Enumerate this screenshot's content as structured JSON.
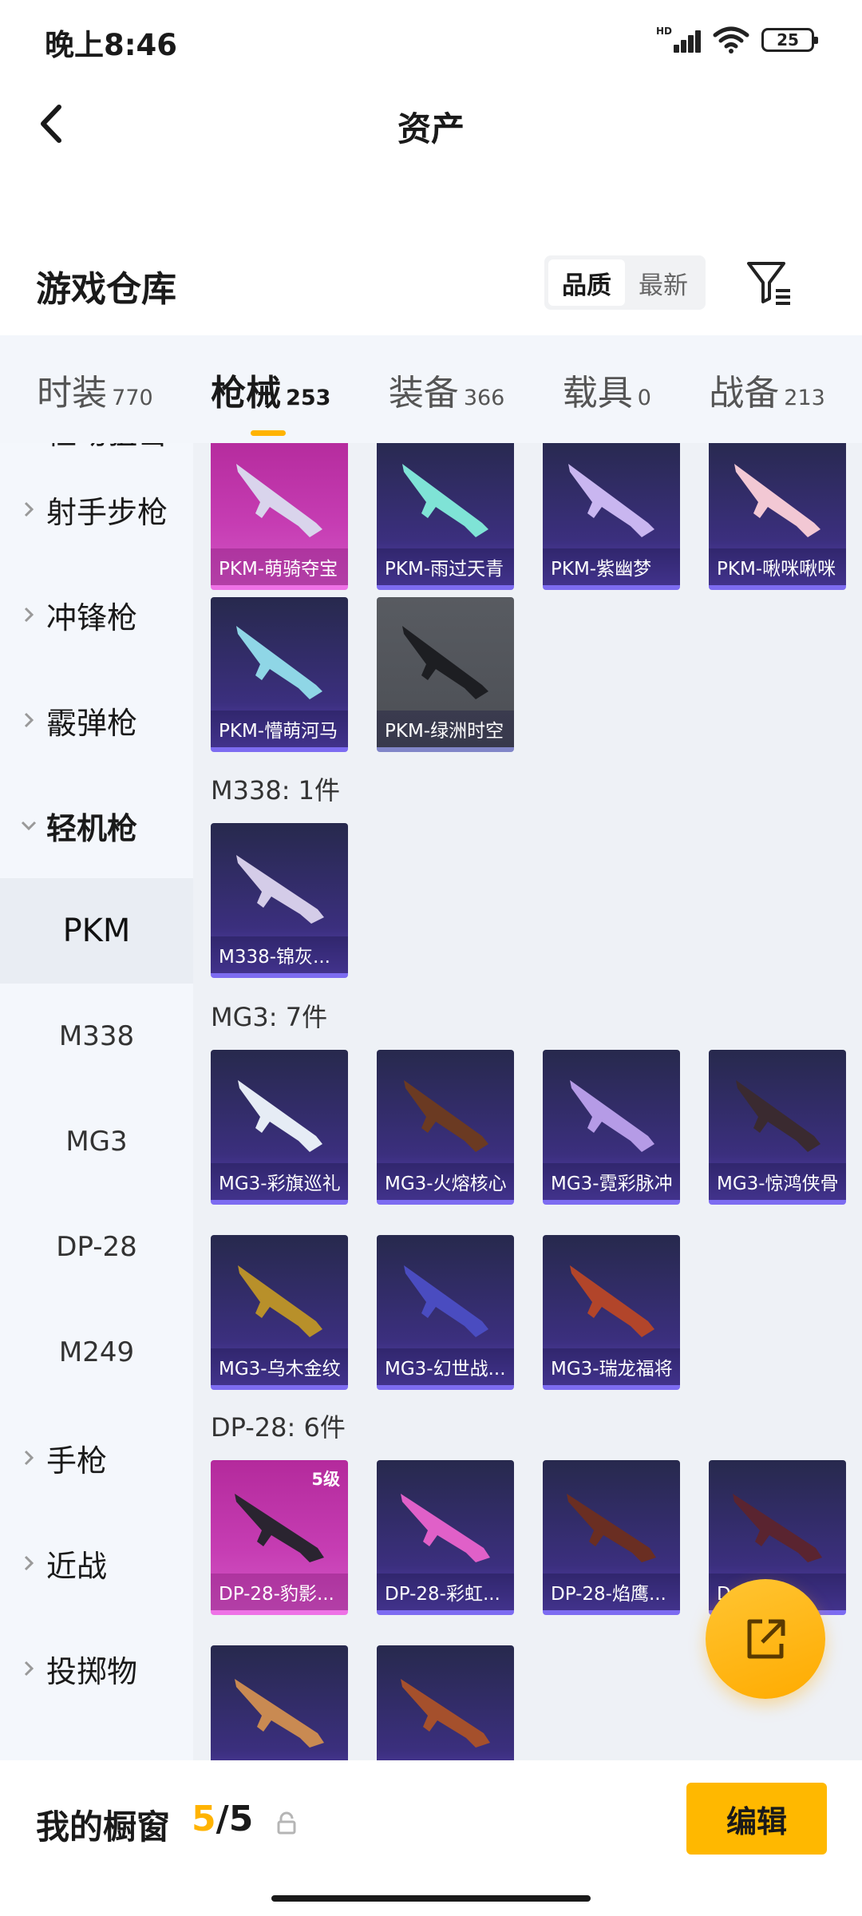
{
  "status": {
    "time": "晚上8:46",
    "network": "HD",
    "battery": "25"
  },
  "header": {
    "title": "资产"
  },
  "section": {
    "title": "游戏仓库",
    "sort_options": [
      "品质",
      "最新"
    ],
    "sort_active": "品质"
  },
  "tabs": [
    {
      "name": "时装",
      "count": "770"
    },
    {
      "name": "枪械",
      "count": "253",
      "active": true
    },
    {
      "name": "装备",
      "count": "366"
    },
    {
      "name": "载具",
      "count": "0"
    },
    {
      "name": "战备",
      "count": "213"
    }
  ],
  "sidebar": {
    "partial_top": "栓动狙击",
    "categories": [
      "射手步枪",
      "冲锋枪",
      "霰弹枪",
      "轻机枪"
    ],
    "open_category": "轻机枪",
    "subitems": [
      "PKM",
      "M338",
      "MG3",
      "DP-28",
      "M249"
    ],
    "active_subitem": "PKM",
    "more_categories": [
      "手枪",
      "近战",
      "投掷物"
    ]
  },
  "groups": {
    "pkm": {
      "row1": [
        "PKM-萌骑夺宝",
        "PKM-雨过天青",
        "PKM-紫幽梦",
        "PKM-啾咪啾咪"
      ],
      "row2": [
        "PKM-懵萌河马",
        "PKM-绿洲时空"
      ]
    },
    "m338": {
      "label": "M338: 1件",
      "items": [
        "M338-锦灰..."
      ]
    },
    "mg3": {
      "label": "MG3: 7件",
      "row1": [
        "MG3-彩旗巡礼",
        "MG3-火熔核心",
        "MG3-霓彩脉冲",
        "MG3-惊鸿侠骨"
      ],
      "row2": [
        "MG3-乌木金纹",
        "MG3-幻世战...",
        "MG3-瑞龙福将"
      ]
    },
    "dp28": {
      "label": "DP-28: 6件",
      "row1": [
        "DP-28-豹影...",
        "DP-28-彩虹...",
        "DP-28-焰鹰...",
        "D...沁..."
      ],
      "badge": "5级"
    }
  },
  "card_colors": {
    "pink": "#c63db3",
    "purple": "#3b2f7e",
    "gray": "#4c4f55",
    "accent": "#ffb300"
  },
  "bottom": {
    "label": "我的橱窗",
    "current": "5",
    "separator": "/",
    "total": "5",
    "edit": "编辑"
  },
  "icons": {
    "back": "chevron-left-icon",
    "filter": "filter-icon",
    "share": "share-icon",
    "lock": "lock-icon"
  }
}
